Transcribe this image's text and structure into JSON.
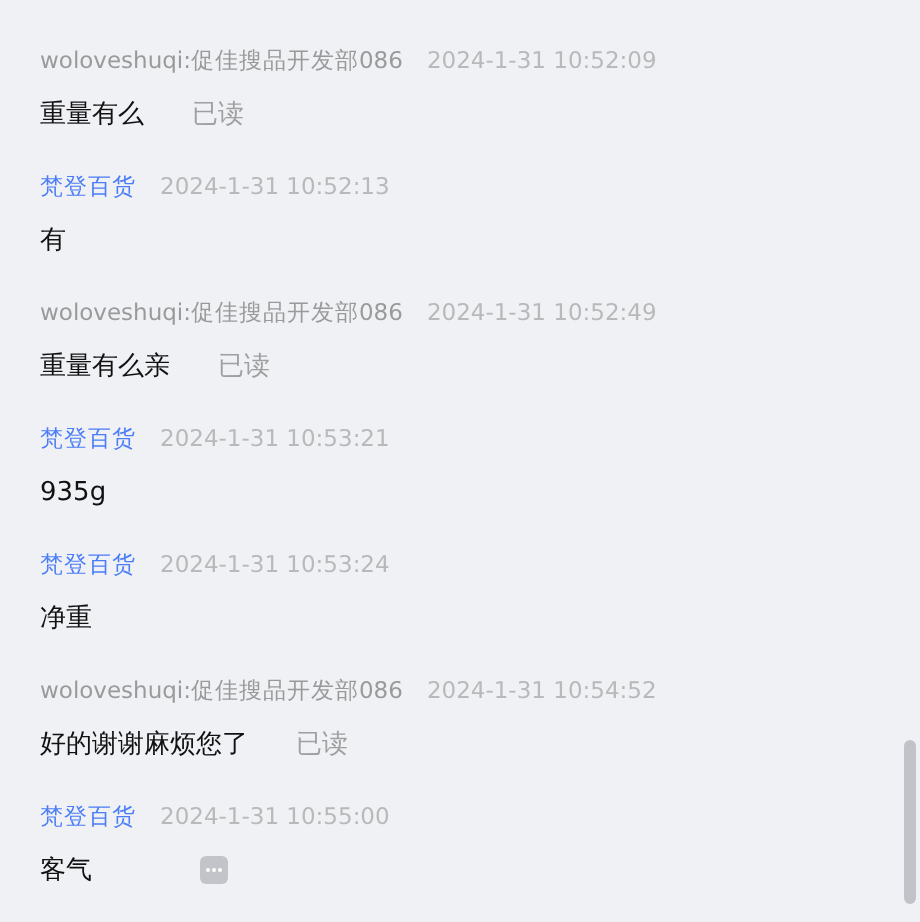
{
  "messages": [
    {
      "sender": "woloveshuqi:促佳搜品开发部086",
      "kind": "customer",
      "time": "2024-1-31 10:52:09",
      "text": "重量有么",
      "status": "已读",
      "more_menu": false
    },
    {
      "sender": "梵登百货",
      "kind": "shop",
      "time": "2024-1-31 10:52:13",
      "text": "有",
      "more_menu": false
    },
    {
      "sender": "woloveshuqi:促佳搜品开发部086",
      "kind": "customer",
      "time": "2024-1-31 10:52:49",
      "text": "重量有么亲",
      "status": "已读",
      "more_menu": false
    },
    {
      "sender": "梵登百货",
      "kind": "shop",
      "time": "2024-1-31 10:53:21",
      "text": "935g",
      "more_menu": false
    },
    {
      "sender": "梵登百货",
      "kind": "shop",
      "time": "2024-1-31 10:53:24",
      "text": "净重",
      "more_menu": false
    },
    {
      "sender": "woloveshuqi:促佳搜品开发部086",
      "kind": "customer",
      "time": "2024-1-31 10:54:52",
      "text": "好的谢谢麻烦您了",
      "status": "已读",
      "more_menu": false
    },
    {
      "sender": "梵登百货",
      "kind": "shop",
      "time": "2024-1-31 10:55:00",
      "text": "客气",
      "more_menu": true
    }
  ]
}
